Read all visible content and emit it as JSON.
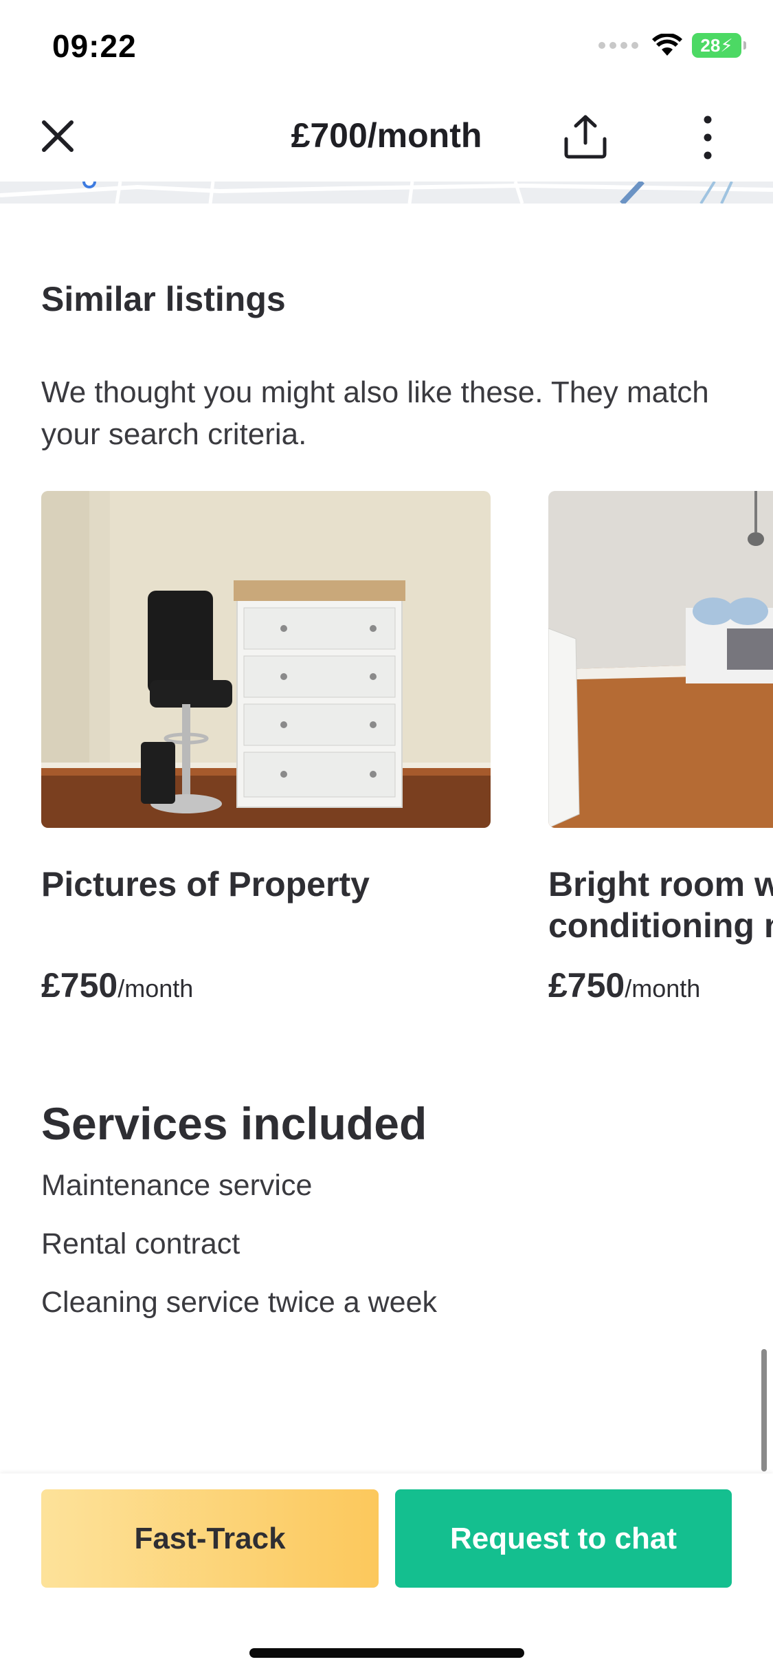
{
  "status_bar": {
    "time": "09:22",
    "battery": "28",
    "icons": [
      "signal-icon",
      "wifi-icon",
      "battery-icon"
    ]
  },
  "header": {
    "title": "£700/month",
    "icons": [
      "close-icon",
      "share-icon",
      "more-vertical-icon"
    ]
  },
  "similar": {
    "title": "Similar listings",
    "description": "We thought you might also like these. They match your search criteria.",
    "listings": [
      {
        "title": "Pictures of Property",
        "price": "£750",
        "period": "/month"
      },
      {
        "title": "Bright room with air conditioning near",
        "price": "£750",
        "period": "/month"
      }
    ]
  },
  "services": {
    "title": "Services included",
    "items": [
      "Maintenance service",
      "Rental contract",
      "Cleaning service twice a week"
    ]
  },
  "actions": {
    "fast_track": "Fast-Track",
    "request_chat": "Request to chat"
  },
  "colors": {
    "primary": "#14bf8f",
    "fast_track_start": "#fde29a",
    "fast_track_end": "#fcc85c",
    "text": "#2e2e33"
  }
}
